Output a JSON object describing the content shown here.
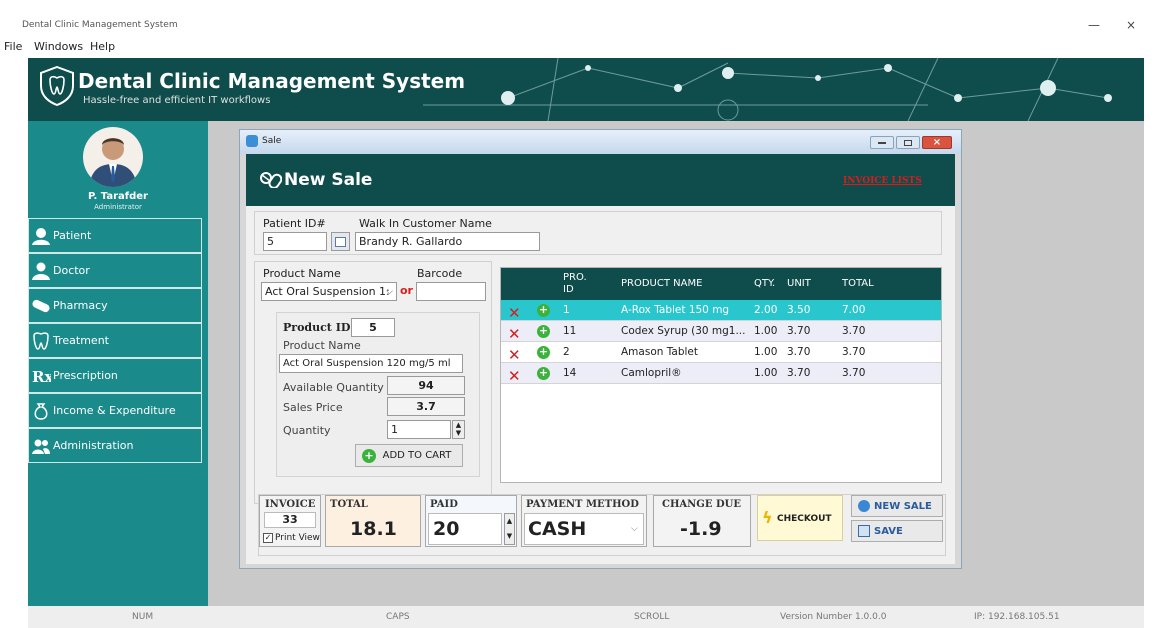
{
  "window": {
    "title": "Dental Clinic Management System",
    "minimize": "—",
    "close": "×"
  },
  "menu": [
    "File",
    "Windows",
    "Help"
  ],
  "header": {
    "title": "Dental Clinic Management System",
    "subtitle": "Hassle-free and efficient IT workflows"
  },
  "user": {
    "name": "P. Tarafder",
    "role": "Administrator"
  },
  "sidebar": {
    "items": [
      {
        "label": "Patient",
        "icon": "patient-icon"
      },
      {
        "label": "Doctor",
        "icon": "doctor-icon"
      },
      {
        "label": "Pharmacy",
        "icon": "pill-icon"
      },
      {
        "label": "Treatment",
        "icon": "tooth-icon"
      },
      {
        "label": "Prescription",
        "icon": "rx-icon"
      },
      {
        "label": "Income & Expenditure",
        "icon": "money-bag-icon"
      },
      {
        "label": "Administration",
        "icon": "users-icon"
      }
    ]
  },
  "dialog": {
    "title": "Sale",
    "heading": "New Sale",
    "invoice_link": "INVOICE LISTS"
  },
  "patient": {
    "id_label": "Patient ID#",
    "id_value": "5",
    "walkin_label": "Walk In Customer Name",
    "walkin_value": "Brandy R. Gallardo"
  },
  "product_select": {
    "name_label": "Product Name",
    "barcode_label": "Barcode",
    "selected": "Act Oral Suspension 1:",
    "or_label": "or",
    "barcode_value": ""
  },
  "product_detail": {
    "id_label": "Product ID",
    "id_value": "5",
    "name_label": "Product Name",
    "name_value": "Act Oral Suspension 120 mg/5 ml",
    "avail_label": "Available Quantity",
    "avail_value": "94",
    "price_label": "Sales Price",
    "price_value": "3.7",
    "qty_label": "Quantity",
    "qty_value": "1",
    "add_button": "ADD TO CART"
  },
  "cart": {
    "columns": {
      "pro": "PRO.",
      "id": "ID",
      "name": "PRODUCT NAME",
      "qty": "QTY.",
      "unit": "UNIT",
      "total": "TOTAL"
    },
    "rows": [
      {
        "id": "1",
        "name": "A-Rox Tablet 150 mg",
        "qty": "2.00",
        "unit": "3.50",
        "total": "7.00"
      },
      {
        "id": "11",
        "name": "Codex Syrup (30 mg1...",
        "qty": "1.00",
        "unit": "3.70",
        "total": "3.70"
      },
      {
        "id": "2",
        "name": "Amason Tablet",
        "qty": "1.00",
        "unit": "3.70",
        "total": "3.70"
      },
      {
        "id": "14",
        "name": "Camlopril®",
        "qty": "1.00",
        "unit": "3.70",
        "total": "3.70"
      }
    ]
  },
  "summary": {
    "invoice_label": "INVOICE",
    "invoice_value": "33",
    "print_view": "Print View",
    "total_label": "TOTAL",
    "total_value": "18.1",
    "paid_label": "PAID",
    "paid_value": "20",
    "method_label": "PAYMENT METHOD",
    "method_value": "CASH",
    "change_label": "CHANGE DUE",
    "change_value": "-1.9",
    "checkout": "CHECKOUT",
    "new_sale": "NEW SALE",
    "save": "SAVE"
  },
  "status": {
    "num": "NUM",
    "caps": "CAPS",
    "scroll": "SCROLL",
    "version": "Version Number 1.0.0.0",
    "ip": "IP: 192.168.105.51"
  },
  "colors": {
    "brand": "#0f4c4c",
    "sidebar": "#1a8a8a",
    "selected_row": "#29c6ce",
    "link": "#d91c1c"
  }
}
